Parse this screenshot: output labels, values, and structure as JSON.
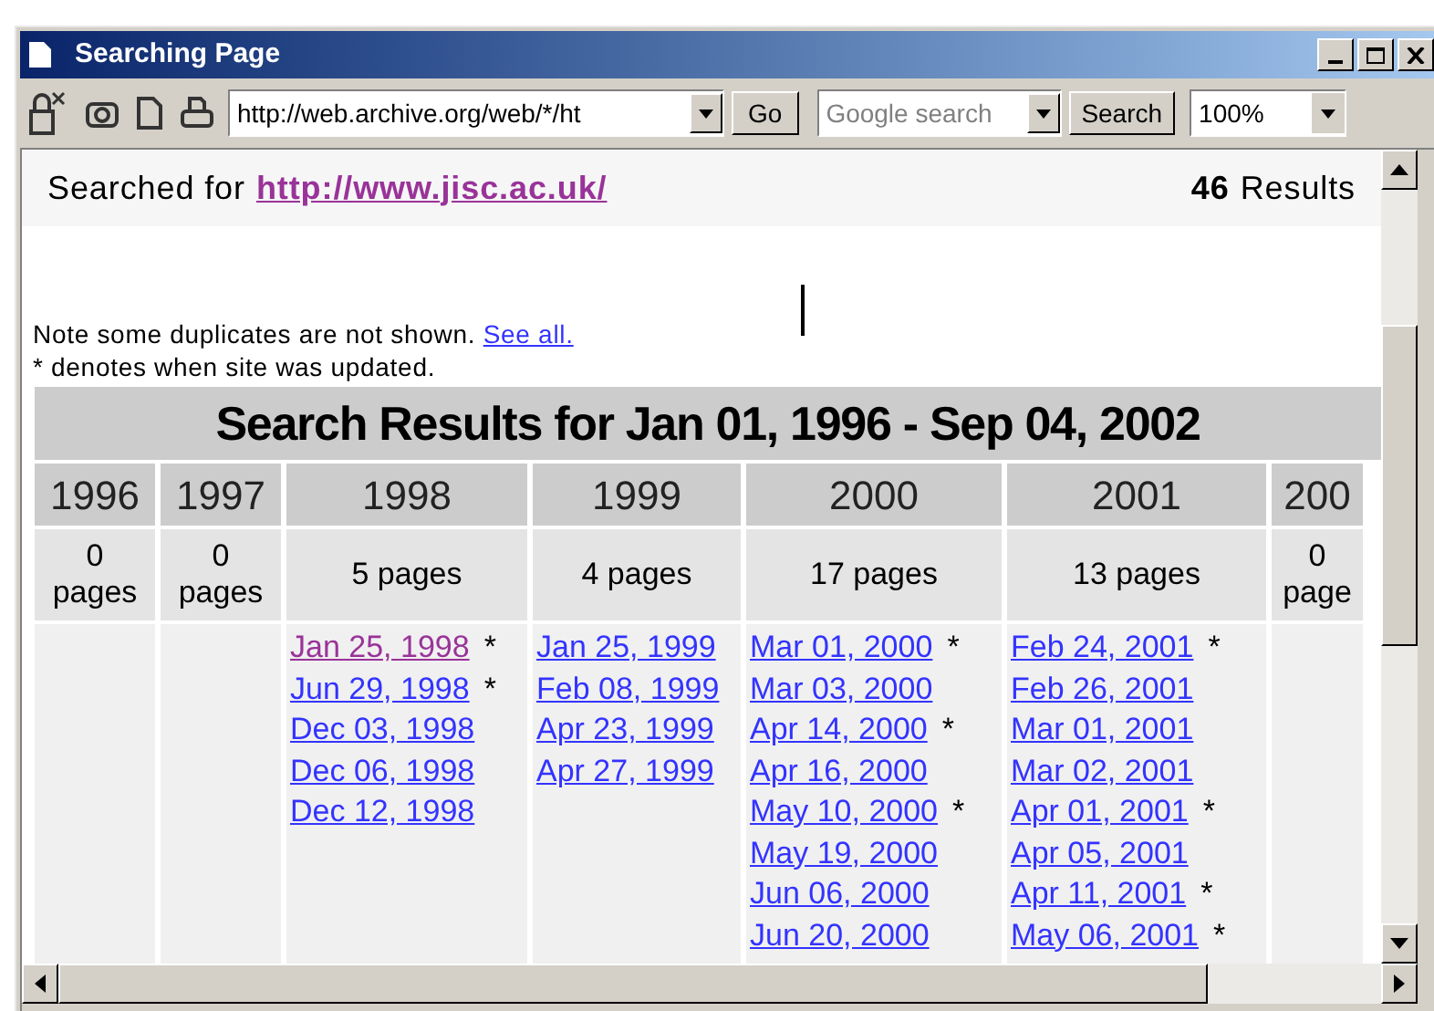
{
  "window": {
    "title": "Searching Page"
  },
  "toolbar": {
    "address": "http://web.archive.org/web/*/ht",
    "go_button": "Go",
    "search": {
      "placeholder": "Google search"
    },
    "search_button": "Search",
    "zoom": "100%"
  },
  "summary": {
    "prefix": "Searched for",
    "url": "http://www.jisc.ac.uk/",
    "count": "46",
    "count_label": "Results"
  },
  "notes": {
    "text": "Note some duplicates are not shown.",
    "link": "See all.",
    "legend": "* denotes when site was updated."
  },
  "results": {
    "title": "Search Results for Jan 01, 1996 - Sep 04, 2002",
    "columns": [
      {
        "year": "1996",
        "pages": "0 pages"
      },
      {
        "year": "1997",
        "pages": "0 pages"
      },
      {
        "year": "1998",
        "pages": "5 pages",
        "entries": [
          {
            "date": "Jan 25, 1998",
            "visited": true,
            "note": "*"
          },
          {
            "date": "Jun 29, 1998",
            "visited": false,
            "note": "*"
          },
          {
            "date": "Dec 03, 1998",
            "visited": false
          },
          {
            "date": "Dec 06, 1998",
            "visited": false
          },
          {
            "date": "Dec 12, 1998",
            "visited": false
          }
        ]
      },
      {
        "year": "1999",
        "pages": "4 pages",
        "entries": [
          {
            "date": "Jan 25, 1999",
            "visited": false
          },
          {
            "date": "Feb 08, 1999",
            "visited": false
          },
          {
            "date": "Apr 23, 1999",
            "visited": false
          },
          {
            "date": "Apr 27, 1999",
            "visited": false
          }
        ]
      },
      {
        "year": "2000",
        "pages": "17 pages",
        "entries": [
          {
            "date": "Mar 01, 2000",
            "visited": false,
            "note": "*"
          },
          {
            "date": "Mar 03, 2000",
            "visited": false
          },
          {
            "date": "Apr 14, 2000",
            "visited": false,
            "note": "*"
          },
          {
            "date": "Apr 16, 2000",
            "visited": false
          },
          {
            "date": "May 10, 2000",
            "visited": false,
            "note": "*"
          },
          {
            "date": "May 19, 2000",
            "visited": false
          },
          {
            "date": "Jun 06, 2000",
            "visited": false
          },
          {
            "date": "Jun 20, 2000",
            "visited": false
          }
        ]
      },
      {
        "year": "2001",
        "pages": "13 pages",
        "entries": [
          {
            "date": "Feb 24, 2001",
            "visited": false,
            "note": "*"
          },
          {
            "date": "Feb 26, 2001",
            "visited": false
          },
          {
            "date": "Mar 01, 2001",
            "visited": false
          },
          {
            "date": "Mar 02, 2001",
            "visited": false
          },
          {
            "date": "Apr 01, 2001",
            "visited": false,
            "note": "*"
          },
          {
            "date": "Apr 05, 2001",
            "visited": false
          },
          {
            "date": "Apr 11, 2001",
            "visited": false,
            "note": "*"
          },
          {
            "date": "May 06, 2001",
            "visited": false,
            "note": "*"
          }
        ]
      },
      {
        "year": "200",
        "pages": "0 page"
      }
    ]
  }
}
